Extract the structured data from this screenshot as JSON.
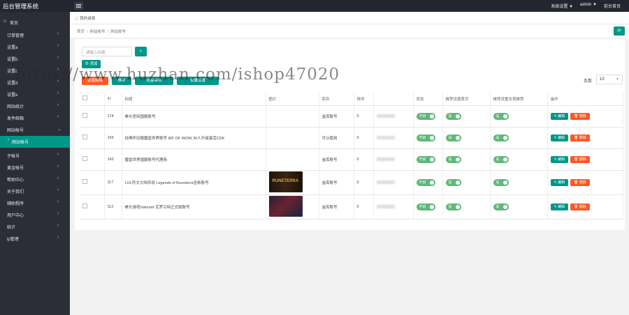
{
  "app": {
    "title": "后台管理系统"
  },
  "topbar": {
    "settings": "系统设置 ▼",
    "user": "admin ▼",
    "front": "前台首页"
  },
  "sidebar": {
    "home": "首页",
    "items": [
      {
        "label": "订单管理",
        "chevron": "‹"
      },
      {
        "label": "设置a",
        "chevron": "‹"
      },
      {
        "label": "设置b",
        "chevron": "‹"
      },
      {
        "label": "设置c",
        "chevron": "‹"
      },
      {
        "label": "设置d",
        "chevron": "‹"
      },
      {
        "label": "设置e",
        "chevron": "‹"
      },
      {
        "label": "网站统计",
        "chevron": "‹"
      },
      {
        "label": "发件邮箱",
        "chevron": "‹"
      },
      {
        "label": "网站帐号",
        "chevron": "⌄"
      },
      {
        "label": "网站帐号",
        "chevron": ""
      },
      {
        "label": "子帐号",
        "chevron": "‹"
      },
      {
        "label": "黄金帐号",
        "chevron": "‹"
      },
      {
        "label": "帮助中心",
        "chevron": "‹"
      },
      {
        "label": "关于我们",
        "chevron": "‹"
      },
      {
        "label": "辅助程序",
        "chevron": "‹"
      },
      {
        "label": "用户中心",
        "chevron": "‹"
      },
      {
        "label": "统计",
        "chevron": "‹"
      },
      {
        "label": "ip管理",
        "chevron": "‹"
      }
    ]
  },
  "tabs": {
    "current": "我的桌面"
  },
  "breadcrumb": {
    "home": "首页",
    "parent": "网站帐号",
    "current": "网站帐号"
  },
  "search": {
    "placeholder": "请输入标题",
    "icon": "search-icon"
  },
  "buttons": {
    "add": "⊕ 添加",
    "batch": [
      "批量删除",
      "推荐",
      "批量审核",
      "批量设置"
    ],
    "batch_colors": [
      "#ff5722",
      "#009688",
      "#009688",
      "#009688"
    ]
  },
  "pagination": {
    "label": "条数",
    "size": "10"
  },
  "watermark": "https://www.huzhan.com/ishop47020",
  "table": {
    "headers": [
      "",
      "ID",
      "标题",
      "图片",
      "库存",
      "排序",
      "",
      "状态",
      "推荐设置首页",
      "推荐设置仓首推荐",
      "操作"
    ],
    "rows": [
      {
        "id": "174",
        "title": "拳头官网国服账号",
        "image": "",
        "stock": "金库账号",
        "sort": "0",
        "status": "开启",
        "rec1": "是",
        "rec2": "是",
        "edit": "✎ 编辑",
        "del": "🗑 删除"
      },
      {
        "id": "169",
        "title": "经典怀旧服魔兽世界账号 WF OF WOW 30人升级激活CDK",
        "image": "",
        "stock": "可以使用",
        "sort": "0",
        "status": "开启",
        "rec1": "是",
        "rec2": "是",
        "edit": "✎ 编辑",
        "del": "🗑 删除"
      },
      {
        "id": "160",
        "title": "魔兽世界国服账号代理商",
        "image": "",
        "stock": "金库账号",
        "sort": "0",
        "status": "开启",
        "rec1": "是",
        "rec2": "是",
        "edit": "✎ 编辑",
        "del": "🗑 删除"
      },
      {
        "id": "117",
        "title": "LOL符文大陆传说 Legends of Runeterra全新账号",
        "image": "RUNETERRA",
        "stock": "金库账号",
        "sort": "0",
        "status": "开启",
        "rec1": "是",
        "rec2": "是",
        "edit": "✎ 编辑",
        "del": "🗑 删除"
      },
      {
        "id": "112",
        "title": "拳头游戏Valorant 瓦罗兰特正式版账号",
        "image": "",
        "stock": "金库账号",
        "sort": "0",
        "status": "开启",
        "rec1": "是",
        "rec2": "是",
        "edit": "✎ 编辑",
        "del": "🗑 删除"
      }
    ]
  },
  "colors": {
    "accent": "#009688",
    "danger": "#ff5722",
    "sidebar": "#2b2e36",
    "topbar": "#23262e",
    "switch": "#5fb878"
  }
}
